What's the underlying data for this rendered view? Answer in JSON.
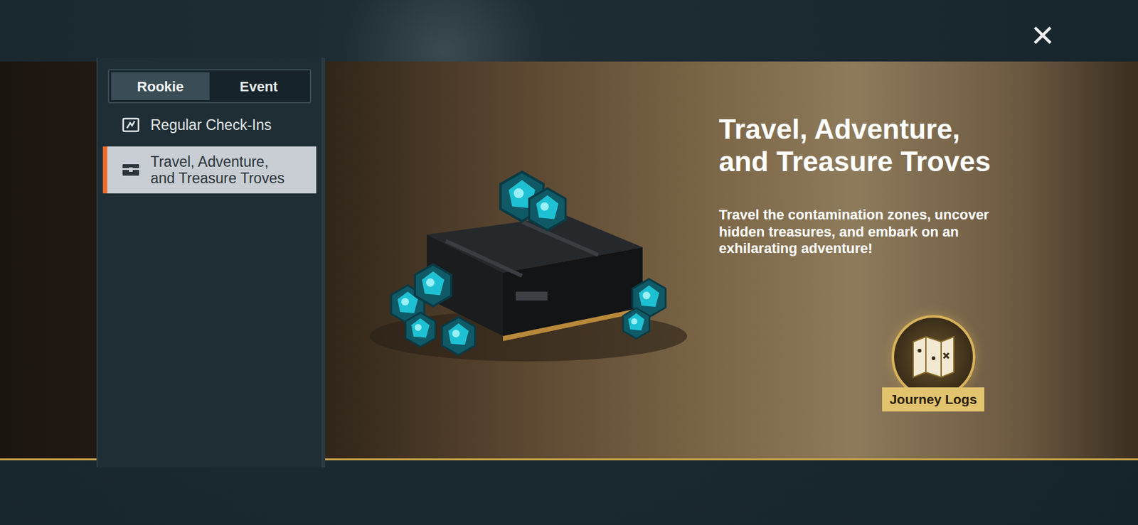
{
  "close": "×",
  "tabs": [
    {
      "label": "Rookie",
      "selected": true
    },
    {
      "label": "Event",
      "selected": false
    }
  ],
  "sidebar": {
    "items": [
      {
        "label": "Regular Check-Ins",
        "selected": false
      },
      {
        "label": "Travel, Adventure, and Treasure Troves",
        "selected": true
      }
    ]
  },
  "banner": {
    "title": "Travel, Adventure, and Treasure Troves",
    "description": "Travel the contamination zones, uncover hidden treasures, and embark on an exhilarating adventure!",
    "badge": "Journey Logs"
  }
}
